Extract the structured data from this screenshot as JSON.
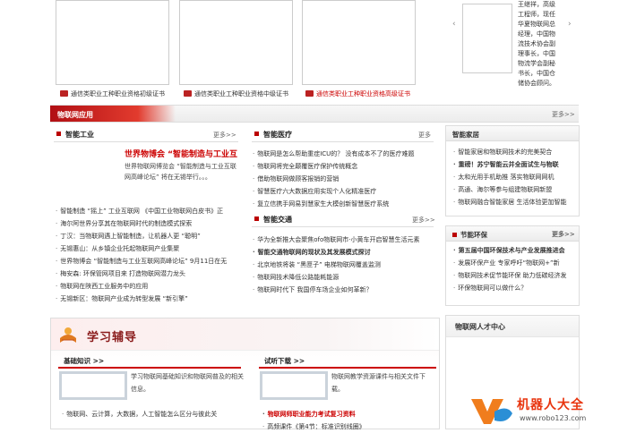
{
  "certificates": [
    {
      "caption": "通信类职业工种职业资格初级证书"
    },
    {
      "caption": "通信类职业工种职业资格中级证书"
    },
    {
      "caption": "通信类职业工种职业资格高级证书"
    }
  ],
  "profile": {
    "text_lines": [
      "王继祥，高级",
      "工程师，现任",
      "华夏物联网总",
      "经理，中国物",
      "流技术协会副",
      "理事长，中国",
      "物流学会副秘",
      "书长，中国仓",
      "储协会顾问。"
    ],
    "prev_arrow": "‹",
    "next_arrow": "›"
  },
  "banner": {
    "title": "物联网应用",
    "more": "更多>>"
  },
  "industry": {
    "title": "智能工业",
    "more": "更多>>",
    "feature_title": "世界物博会 “智能制造与工业互",
    "feature_desc": "世界物联网博览会 “智能制造与工业互联网高峰论坛” 将在无锡举行。。。",
    "items": [
      "智能制造 “摇上” 工业互联网 《中国工业物联网白皮书》正",
      "海尔阿世界分享其在物联网时代的制造模式探索",
      "丁汉：当物联网遇上智能制造，让机器人更 “聪明”",
      "无锡惠山：从乡镇企业托起物联网产业集聚",
      "世界物博会 “智能制造与工业互联网高峰论坛” 9月11日在无",
      "梅安森: 环保管网项目来 打造物联网潜力龙头",
      "物联网在陕西工业服务中的应用",
      "无锡新区：物联网产业成为转型发展 “新引擎”"
    ]
  },
  "medical": {
    "title": "智能医疗",
    "more": "更多",
    "items": [
      "物联网是怎么帮助重症ICU的？ 没有成本不了的医疗难题",
      "物联网将完全颠覆医疗保护传统概念",
      "借助物联网做顾客报销的营销",
      "智慧医疗六大数据应用实现个人化精准医疗",
      "复立信携手网易到慧家生大模创新智慧医疗系统"
    ]
  },
  "traffic": {
    "title": "智能交通",
    "more": "更多>>",
    "items": [
      {
        "text": "华为全新推大会聚焦ofo物联网市·小黄车开启智慧生活元素",
        "bold": false
      },
      {
        "text": "智能交通物联网的现状及其发展模式探讨",
        "bold": true
      },
      {
        "text": "北京地铁将装 “黑匣子” 电梯物联网覆盖监测",
        "bold": false
      },
      {
        "text": "物联网技术降低公路能耗能源",
        "bold": false
      },
      {
        "text": "物联网时代下 我国停车场企业如何革新？",
        "bold": false
      }
    ]
  },
  "home": {
    "title": "智能家居",
    "items": [
      {
        "text": "智能家居和物联网技术的完美契合",
        "bold": false
      },
      {
        "text": "重磅！苏宁智能云并全面试生与物联",
        "bold": true
      },
      {
        "text": "太和光用手机助推 落实物联网网机",
        "bold": false
      },
      {
        "text": "高通、海尔等参与组建物联网新盟",
        "bold": false
      },
      {
        "text": "物联网融合智能家居 生活体验更加智能",
        "bold": false
      }
    ]
  },
  "eco": {
    "title": "节能环保",
    "more": "更多>>",
    "items": [
      {
        "text": "第五届中国环保技术与产业发展推进会",
        "bold": true
      },
      {
        "text": "发展环保产业 专家呼吁“物联网+”新",
        "bold": false
      },
      {
        "text": "物联网技术促节能环保 助力低碳经济发",
        "bold": false
      },
      {
        "text": "环保物联网可以做什么？",
        "bold": false
      }
    ]
  },
  "study": {
    "title": "学习辅导",
    "basic": {
      "title": "基础知识 >>",
      "desc": "学习物联网基础知识和物联网普及的相关信息。",
      "items": [
        "物联网、云计算，大数据，人工智能怎么区分与彼此关"
      ]
    },
    "test": {
      "title": "试听下载 >>",
      "desc": "物联网教学资源课件与相关文件下载。",
      "items": [
        {
          "text": "物联网师职业能力考试复习资料",
          "red": true
        },
        {
          "text": "高频课件《第4节：标准识别线圈》",
          "red": false
        }
      ]
    }
  },
  "talent": {
    "title": "物联网人才中心"
  },
  "watermark": {
    "brand": "机器人大全",
    "url": "www.robo123.com"
  },
  "colors": {
    "accent": "#c00000",
    "banner": "#c1121a"
  }
}
